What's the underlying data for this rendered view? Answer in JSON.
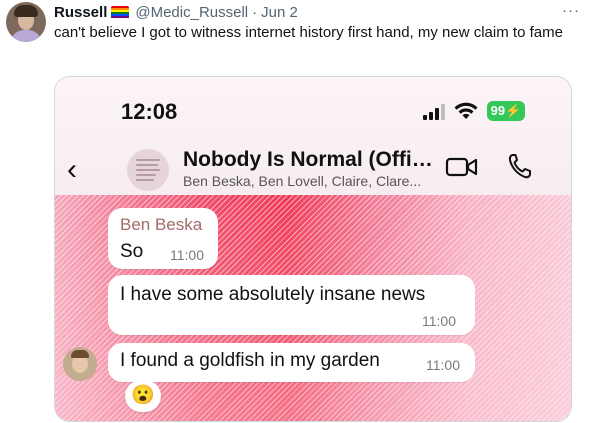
{
  "tweet": {
    "display_name": "Russell",
    "handle": "@Medic_Russell",
    "separator": "·",
    "date": "Jun 2",
    "more_label": "···",
    "text": "can't believe I got to witness internet history first hand, my new claim to fame",
    "pride_flag_colors": [
      "#e40303",
      "#ff8c00",
      "#ffed00",
      "#008026",
      "#004dff",
      "#750787"
    ]
  },
  "phone": {
    "status_time": "12:08",
    "battery_level": "99",
    "battery_color": "#34c759",
    "back_icon": "chevron-left-icon",
    "group_title": "Nobody Is Normal (Officia...",
    "group_members": "Ben Beska, Ben Lovell, Claire, Clare...",
    "icons": [
      "video-call-icon",
      "phone-call-icon",
      "signal-icon",
      "wifi-icon"
    ]
  },
  "chat": {
    "messages": [
      {
        "sender": "Ben Beska",
        "text": "So",
        "time": "11:00"
      },
      {
        "text": "I have some absolutely insane news",
        "time": "11:00"
      },
      {
        "text": "I found a goldfish in my garden",
        "time": "11:00",
        "reaction": "😮"
      }
    ],
    "sender_name_color": "#a36b6a"
  }
}
